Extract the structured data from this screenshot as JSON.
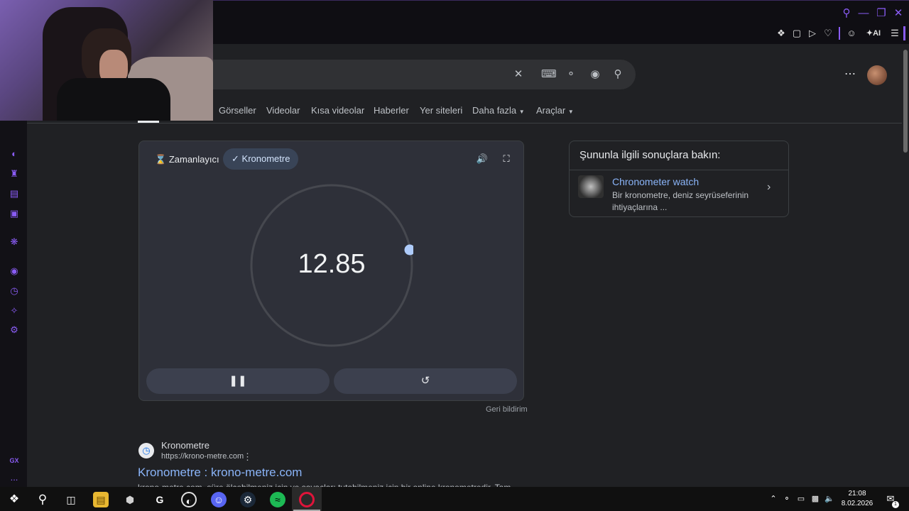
{
  "window": {
    "toolbar_ai_label": "AI"
  },
  "tabs": [
    {
      "label": "Görseller"
    },
    {
      "label": "Videolar"
    },
    {
      "label": "Kısa videolar"
    },
    {
      "label": "Haberler"
    },
    {
      "label": "Yer siteleri"
    },
    {
      "label": "Daha fazla"
    },
    {
      "label": "Araçlar"
    }
  ],
  "stopwatch": {
    "mode_timer_label": "Zamanlayıcı",
    "mode_stopwatch_label": "Kronometre",
    "time": "12.85",
    "feedback_label": "Geri bildirim"
  },
  "related": {
    "title": "Şununla ilgili sonuçlara bakın:",
    "item_title": "Chronometer watch",
    "item_desc": "Bir kronometre, deniz seyrüseferinin ihtiyaçlarına ..."
  },
  "result": {
    "site_name": "Kronometre",
    "url": "https://krono-metre.com",
    "title": "Kronometre : krono-metre.com",
    "snippet": "krono-metre.com, süre ölçebilmeniz için ve sayaçları tutabilmeniz için bir online kronometredir. Tam"
  },
  "sidebar": {
    "gx_label": "GX",
    "more_label": "..."
  },
  "taskbar": {
    "time": "21:08",
    "date": "8.02.2026",
    "notification_count": "1"
  },
  "colors": {
    "accent_purple": "#8a5cf5",
    "link_blue": "#8ab4f8",
    "card_bg": "#2e3039",
    "page_bg": "#202124"
  }
}
